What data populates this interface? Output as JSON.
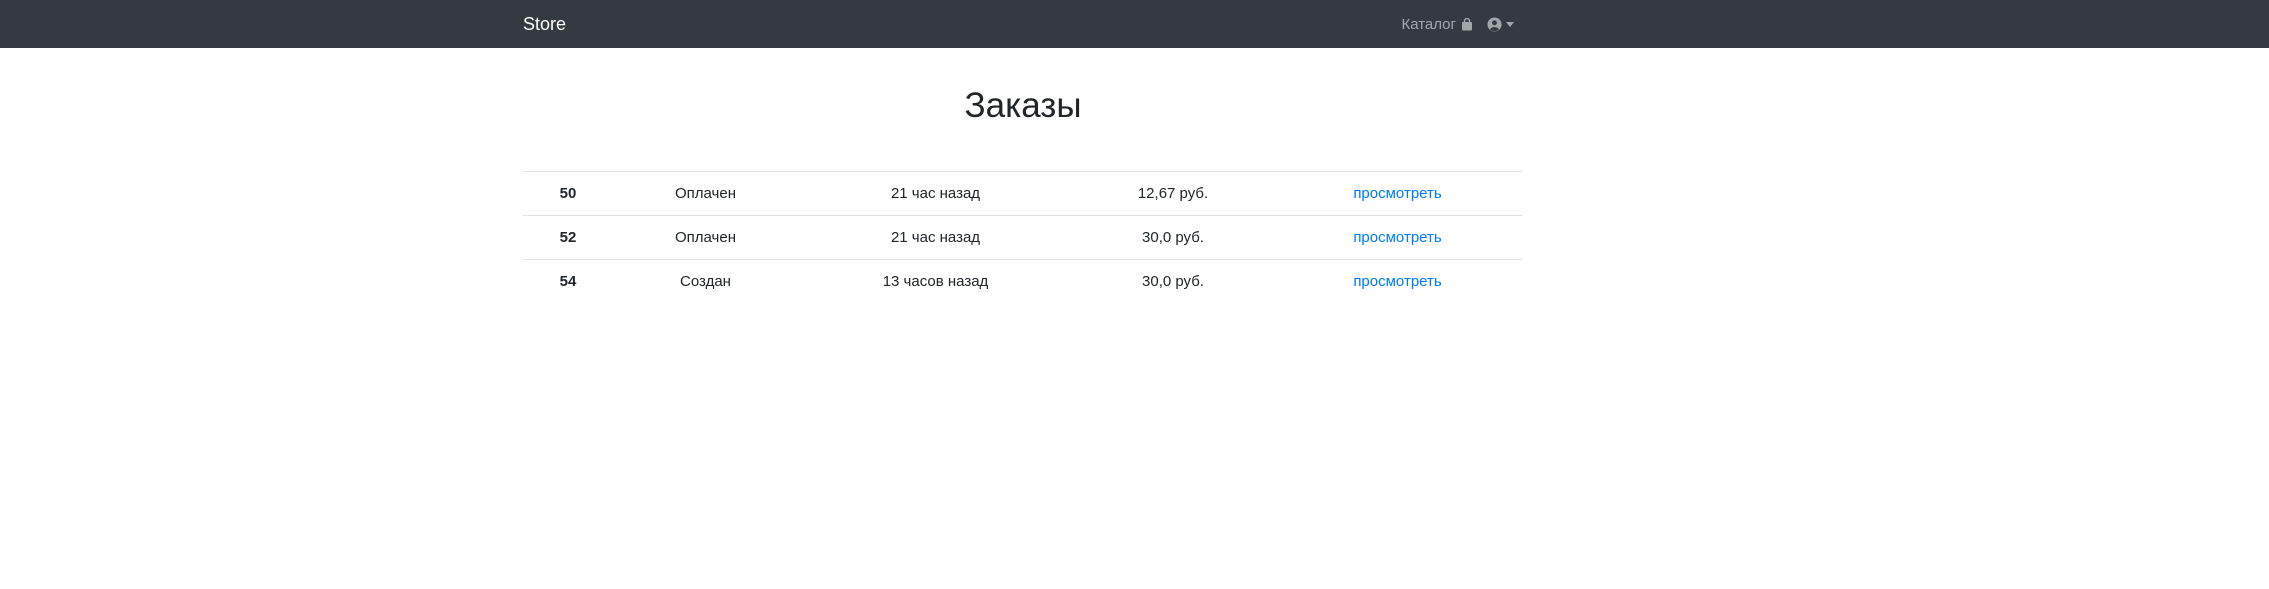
{
  "navbar": {
    "brand": "Store",
    "catalog_label": "Каталог",
    "icons": {
      "catalog": "shopping-bag-icon",
      "user": "user-circle-icon",
      "dropdown": "caret-down-icon"
    }
  },
  "page": {
    "title": "Заказы"
  },
  "orders": [
    {
      "id": "50",
      "status": "Оплачен",
      "time": "21 час назад",
      "price": "12,67 руб.",
      "link": "просмотреть"
    },
    {
      "id": "52",
      "status": "Оплачен",
      "time": "21 час назад",
      "price": "30,0 руб.",
      "link": "просмотреть"
    },
    {
      "id": "54",
      "status": "Создан",
      "time": "13 часов назад",
      "price": "30,0 руб.",
      "link": "просмотреть"
    }
  ],
  "colors": {
    "navbar_bg": "#343a40",
    "link": "#007bff",
    "border": "#dee2e6"
  }
}
